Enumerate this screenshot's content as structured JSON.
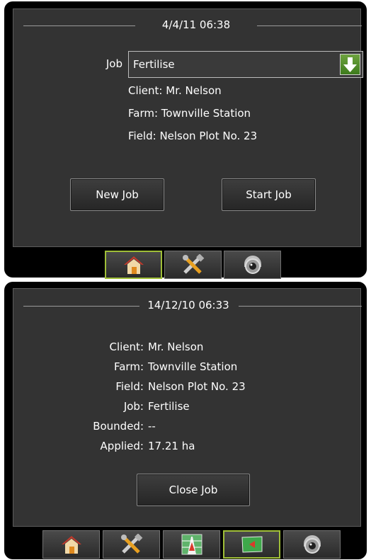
{
  "panel1": {
    "datetime": "4/4/11 06:38",
    "job_label": "Job",
    "job_value": "Fertilise",
    "client": "Client: Mr. Nelson",
    "farm": "Farm: Townville Station",
    "field": "Field: Nelson Plot No. 23",
    "new_job_label": "New Job",
    "start_job_label": "Start Job",
    "tabs": [
      {
        "icon": "home-icon",
        "active": true
      },
      {
        "icon": "tools-icon",
        "active": false
      },
      {
        "icon": "camera-icon",
        "active": false
      }
    ]
  },
  "panel2": {
    "datetime": "14/12/10 06:33",
    "rows": [
      {
        "label": "Client:",
        "value": "Mr. Nelson"
      },
      {
        "label": "Farm:",
        "value": "Townville Station"
      },
      {
        "label": "Field:",
        "value": "Nelson Plot No. 23"
      },
      {
        "label": "Job:",
        "value": "Fertilise"
      },
      {
        "label": "Bounded:",
        "value": "--"
      },
      {
        "label": "Applied:",
        "value": "17.21 ha"
      }
    ],
    "close_job_label": "Close Job",
    "tabs": [
      {
        "icon": "home-icon",
        "active": false
      },
      {
        "icon": "tools-icon",
        "active": false
      },
      {
        "icon": "guidance-icon",
        "active": false
      },
      {
        "icon": "boundary-icon",
        "active": true
      },
      {
        "icon": "camera-icon",
        "active": false
      }
    ]
  },
  "colors": {
    "active_tab": "#9fbe37",
    "dropdown": "#5a952f",
    "screen_bg": "#333333"
  }
}
